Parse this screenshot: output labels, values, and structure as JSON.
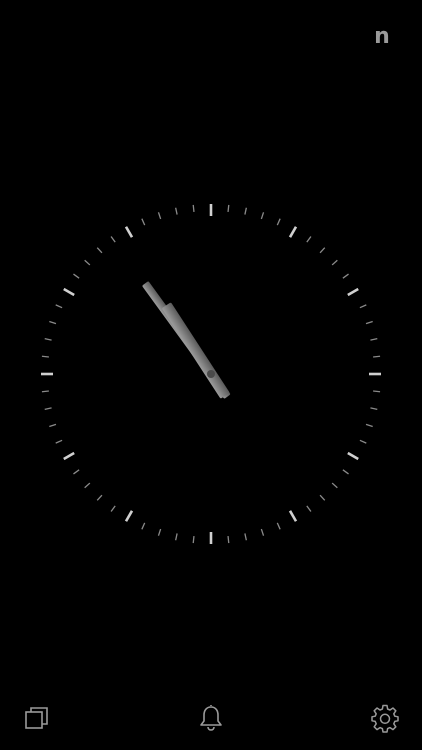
{
  "header": {
    "logo_text": "n"
  },
  "clock": {
    "time_hours": 10,
    "time_minutes": 54,
    "colors": {
      "background": "#000000",
      "tick_minor": "#8a8a8a",
      "tick_major": "#d0d0d0",
      "hand": "#6e6e6e",
      "hand_highlight": "#9c9c9c"
    }
  },
  "toolbar": {
    "items": [
      {
        "name": "copy-windows-icon"
      },
      {
        "name": "bell-icon"
      },
      {
        "name": "gear-icon"
      }
    ],
    "icon_color": "#9a9a9a"
  }
}
